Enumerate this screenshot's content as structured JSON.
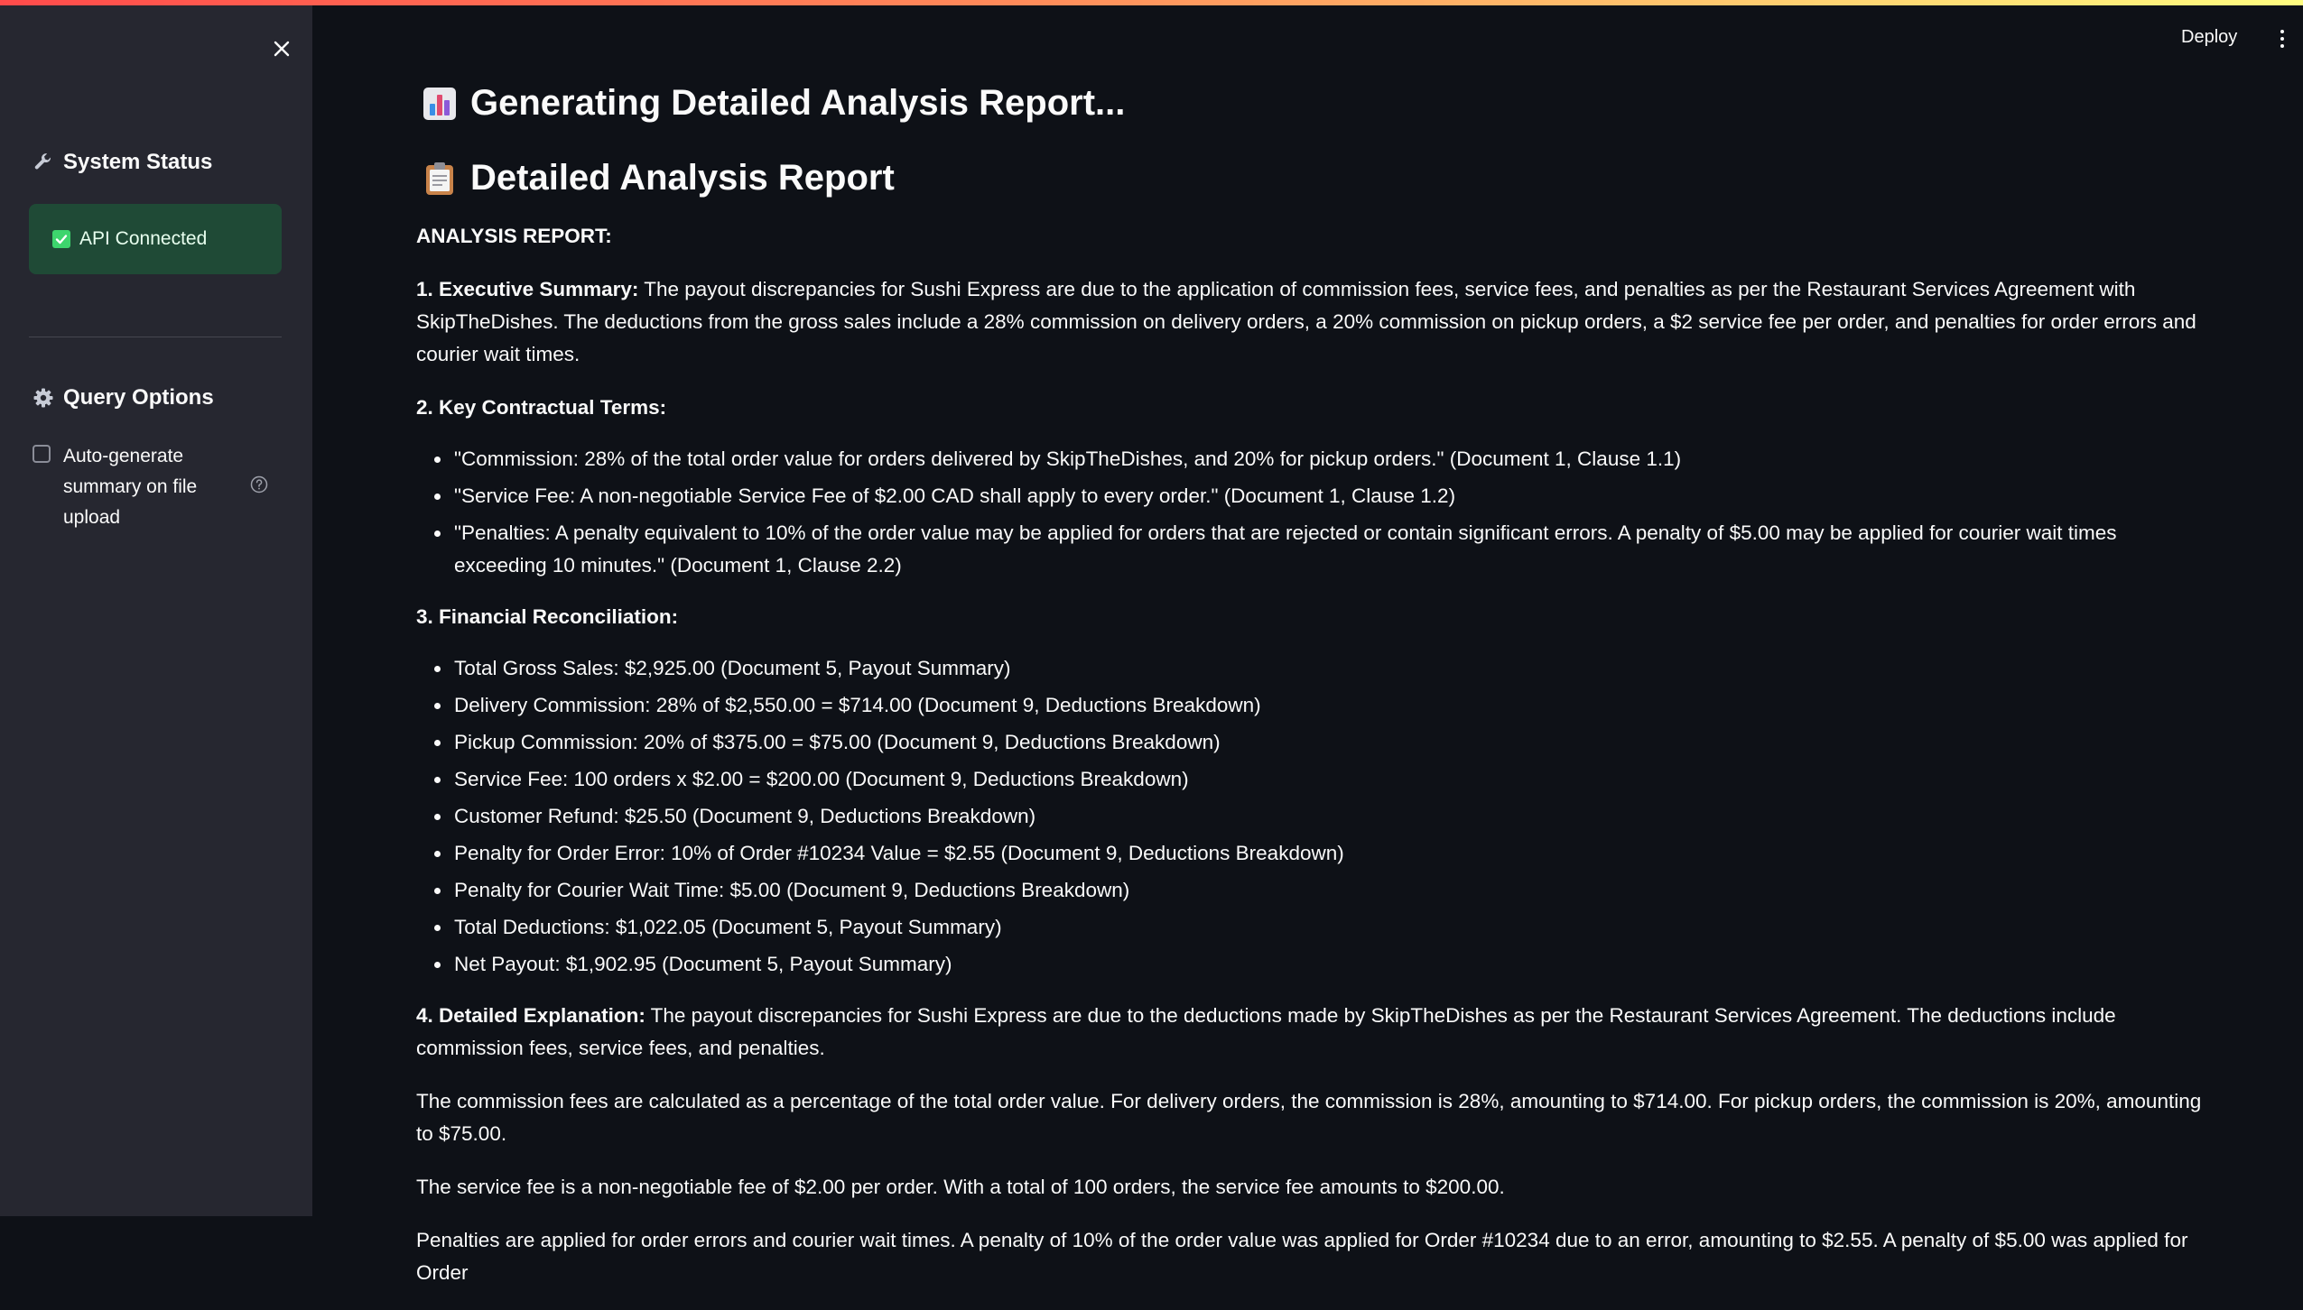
{
  "sidebar": {
    "system_status_title": "System Status",
    "status_text": "API Connected",
    "query_options_title": "Query Options",
    "auto_generate_label": "Auto-generate summary on file upload"
  },
  "header": {
    "deploy_label": "Deploy"
  },
  "main": {
    "generating_title": "Generating Detailed Analysis Report...",
    "report_title": "Detailed Analysis Report",
    "analysis_label": "ANALYSIS REPORT:",
    "executive_summary": {
      "heading": "1. Executive Summary:",
      "text": " The payout discrepancies for Sushi Express are due to the application of commission fees, service fees, and penalties as per the Restaurant Services Agreement with SkipTheDishes. The deductions from the gross sales include a 28% commission on delivery orders, a 20% commission on pickup orders, a $2 service fee per order, and penalties for order errors and courier wait times."
    },
    "key_terms": {
      "heading": "2. Key Contractual Terms:",
      "items": [
        "\"Commission: 28% of the total order value for orders delivered by SkipTheDishes, and 20% for pickup orders.\" (Document 1, Clause 1.1)",
        "\"Service Fee: A non-negotiable Service Fee of $2.00 CAD shall apply to every order.\" (Document 1, Clause 1.2)",
        "\"Penalties: A penalty equivalent to 10% of the order value may be applied for orders that are rejected or contain significant errors. A penalty of $5.00 may be applied for courier wait times exceeding 10 minutes.\" (Document 1, Clause 2.2)"
      ]
    },
    "financial": {
      "heading": "3. Financial Reconciliation:",
      "items": [
        "Total Gross Sales: $2,925.00 (Document 5, Payout Summary)",
        "Delivery Commission: 28% of $2,550.00 = $714.00 (Document 9, Deductions Breakdown)",
        "Pickup Commission: 20% of $375.00 = $75.00 (Document 9, Deductions Breakdown)",
        "Service Fee: 100 orders x $2.00 = $200.00 (Document 9, Deductions Breakdown)",
        "Customer Refund: $25.50 (Document 9, Deductions Breakdown)",
        "Penalty for Order Error: 10% of Order #10234 Value = $2.55 (Document 9, Deductions Breakdown)",
        "Penalty for Courier Wait Time: $5.00 (Document 9, Deductions Breakdown)",
        "Total Deductions: $1,022.05 (Document 5, Payout Summary)",
        "Net Payout: $1,902.95 (Document 5, Payout Summary)"
      ]
    },
    "detailed": {
      "heading": "4. Detailed Explanation:",
      "text": " The payout discrepancies for Sushi Express are due to the deductions made by SkipTheDishes as per the Restaurant Services Agreement. The deductions include commission fees, service fees, and penalties.",
      "paragraphs": [
        "The commission fees are calculated as a percentage of the total order value. For delivery orders, the commission is 28%, amounting to $714.00. For pickup orders, the commission is 20%, amounting to $75.00.",
        "The service fee is a non-negotiable fee of $2.00 per order. With a total of 100 orders, the service fee amounts to $200.00.",
        "Penalties are applied for order errors and courier wait times. A penalty of 10% of the order value was applied for Order #10234 due to an error, amounting to $2.55. A penalty of $5.00 was applied for Order"
      ]
    }
  },
  "icons": {
    "close": "close-icon",
    "wrench": "wrench-icon",
    "check": "checkmark-icon",
    "gear": "gear-icon",
    "help": "help-icon",
    "bar_chart": "bar-chart-icon",
    "clipboard": "clipboard-icon",
    "menu": "kebab-menu-icon"
  },
  "colors": {
    "background": "#0e1117",
    "sidebar": "#262730",
    "success_bg": "#1f4a36",
    "accent": "#ff4b4b"
  }
}
